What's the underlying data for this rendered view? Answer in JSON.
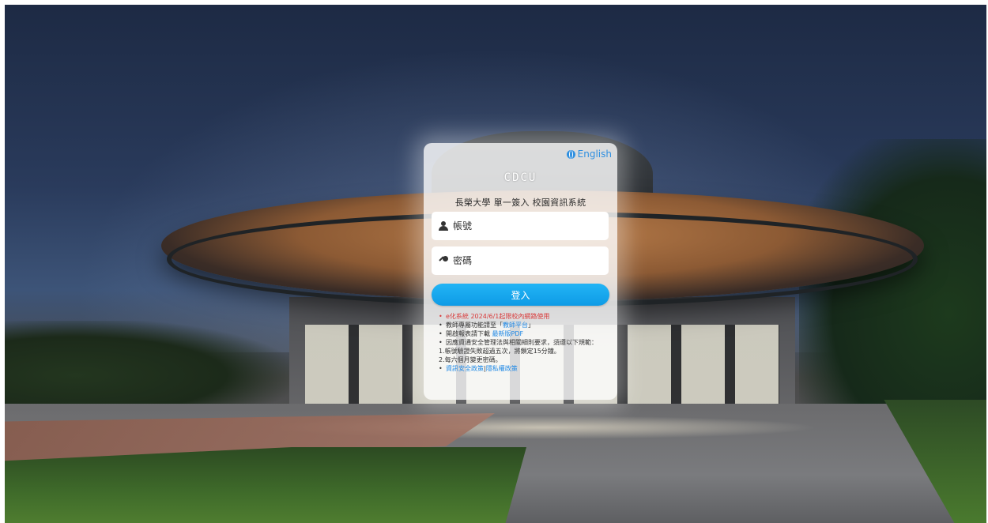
{
  "lang_toggle": "English",
  "logo_text": "CDCU",
  "title": "長榮大學 單一簽入 校園資訊系統",
  "account": {
    "placeholder": "帳號"
  },
  "password": {
    "placeholder": "密碼"
  },
  "login_label": "登入",
  "notes": {
    "notice": "e化系統 2024/6/1起限校內網路使用",
    "teacher_prefix": "教師專屬功能請至「",
    "teacher_link": "教師平台",
    "teacher_suffix": "」",
    "form_prefix": "開啟報表請下載 ",
    "form_link": "最新版PDF",
    "security": "因應資通安全管理法與相關細則要求，須遵以下規範：",
    "rule1": "1.帳號驗證失敗超過五次，將鎖定15分鐘。",
    "rule2": "2.每六個月變更密碼。",
    "policy_link": "資訊安全政策",
    "separator": "|",
    "privacy_link": "隱私權政策"
  }
}
